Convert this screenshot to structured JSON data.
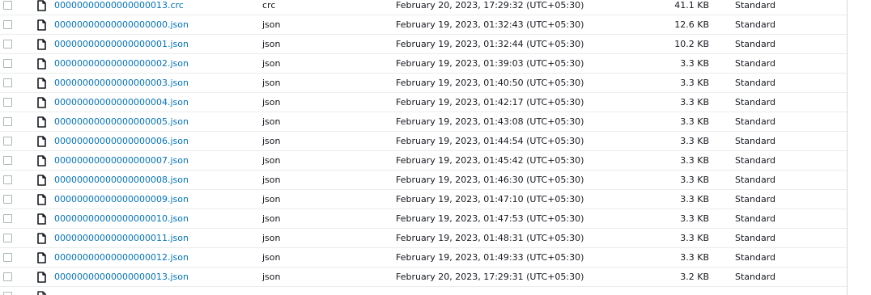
{
  "table": {
    "rows": [
      {
        "name": "00000000000000000013.crc",
        "type": "crc",
        "modified": "February 20, 2023, 17:29:32 (UTC+05:30)",
        "size": "41.1 KB",
        "storage": "Standard"
      },
      {
        "name": "00000000000000000000.json",
        "type": "json",
        "modified": "February 19, 2023, 01:32:43 (UTC+05:30)",
        "size": "12.6 KB",
        "storage": "Standard"
      },
      {
        "name": "00000000000000000001.json",
        "type": "json",
        "modified": "February 19, 2023, 01:32:44 (UTC+05:30)",
        "size": "10.2 KB",
        "storage": "Standard"
      },
      {
        "name": "00000000000000000002.json",
        "type": "json",
        "modified": "February 19, 2023, 01:39:03 (UTC+05:30)",
        "size": "3.3 KB",
        "storage": "Standard"
      },
      {
        "name": "00000000000000000003.json",
        "type": "json",
        "modified": "February 19, 2023, 01:40:50 (UTC+05:30)",
        "size": "3.3 KB",
        "storage": "Standard"
      },
      {
        "name": "00000000000000000004.json",
        "type": "json",
        "modified": "February 19, 2023, 01:42:17 (UTC+05:30)",
        "size": "3.3 KB",
        "storage": "Standard"
      },
      {
        "name": "00000000000000000005.json",
        "type": "json",
        "modified": "February 19, 2023, 01:43:08 (UTC+05:30)",
        "size": "3.3 KB",
        "storage": "Standard"
      },
      {
        "name": "00000000000000000006.json",
        "type": "json",
        "modified": "February 19, 2023, 01:44:54 (UTC+05:30)",
        "size": "3.3 KB",
        "storage": "Standard"
      },
      {
        "name": "00000000000000000007.json",
        "type": "json",
        "modified": "February 19, 2023, 01:45:42 (UTC+05:30)",
        "size": "3.3 KB",
        "storage": "Standard"
      },
      {
        "name": "00000000000000000008.json",
        "type": "json",
        "modified": "February 19, 2023, 01:46:30 (UTC+05:30)",
        "size": "3.3 KB",
        "storage": "Standard"
      },
      {
        "name": "00000000000000000009.json",
        "type": "json",
        "modified": "February 19, 2023, 01:47:10 (UTC+05:30)",
        "size": "3.3 KB",
        "storage": "Standard"
      },
      {
        "name": "00000000000000000010.json",
        "type": "json",
        "modified": "February 19, 2023, 01:47:53 (UTC+05:30)",
        "size": "3.3 KB",
        "storage": "Standard"
      },
      {
        "name": "00000000000000000011.json",
        "type": "json",
        "modified": "February 19, 2023, 01:48:31 (UTC+05:30)",
        "size": "3.3 KB",
        "storage": "Standard"
      },
      {
        "name": "00000000000000000012.json",
        "type": "json",
        "modified": "February 19, 2023, 01:49:33 (UTC+05:30)",
        "size": "3.3 KB",
        "storage": "Standard"
      },
      {
        "name": "00000000000000000013.json",
        "type": "json",
        "modified": "February 20, 2023, 17:29:31 (UTC+05:30)",
        "size": "3.2 KB",
        "storage": "Standard"
      }
    ]
  },
  "icons": {
    "file": "file-icon",
    "checkbox": "checkbox"
  },
  "colors": {
    "link": "#0073bb",
    "row_border": "#eaeded",
    "checkbox_border": "#aab7b8"
  }
}
